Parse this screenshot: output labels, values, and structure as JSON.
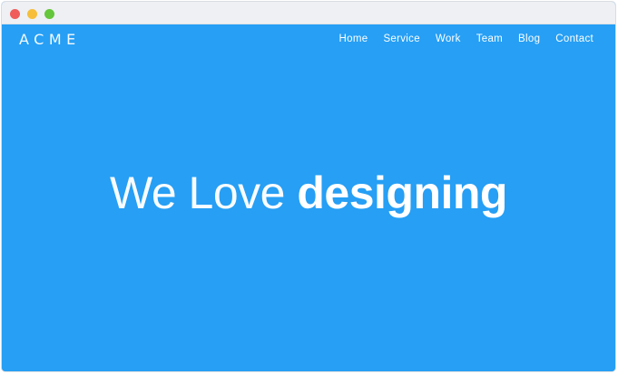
{
  "window": {
    "controls": [
      "close",
      "minimize",
      "maximize"
    ]
  },
  "site": {
    "brand": "ACME",
    "nav": [
      "Home",
      "Service",
      "Work",
      "Team",
      "Blog",
      "Contact"
    ],
    "hero": {
      "light": "We Love",
      "bold": "designing"
    }
  },
  "colors": {
    "background": "#269ff5",
    "text": "#ffffff",
    "titlebar": "#eef0f3",
    "close": "#ef5c5a",
    "minimize": "#f6be3a",
    "maximize": "#64c63a"
  }
}
